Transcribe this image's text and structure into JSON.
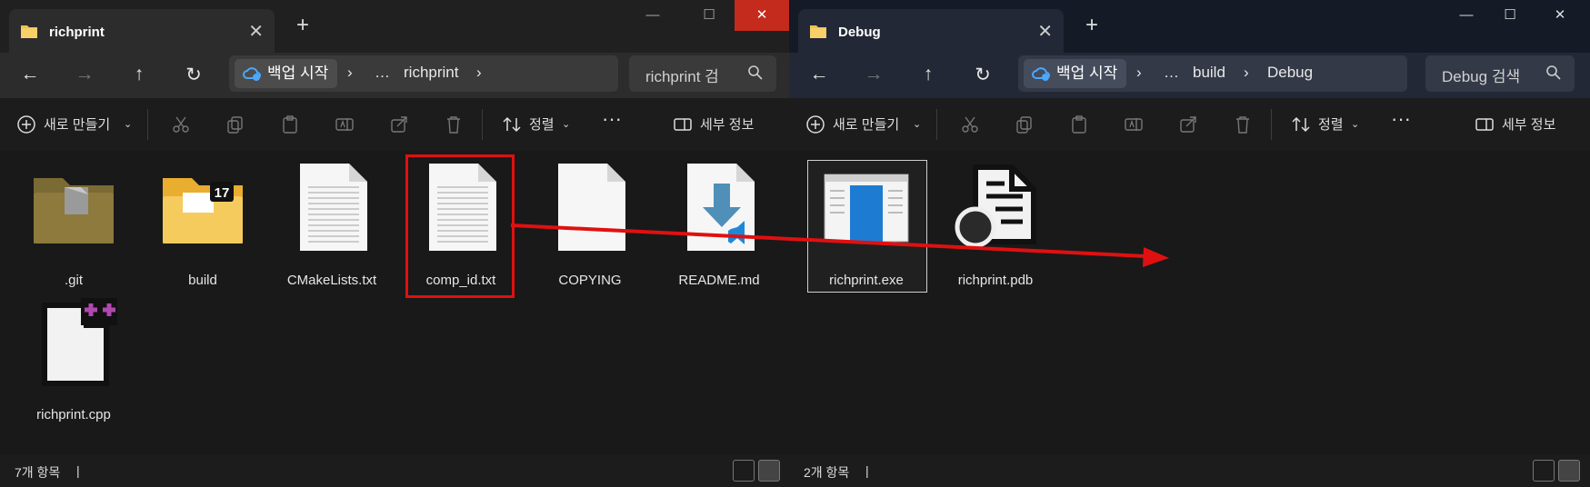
{
  "left": {
    "tab_title": "richprint",
    "address": {
      "root_label": "백업 시작",
      "crumbs": [
        "…",
        "richprint",
        "›"
      ]
    },
    "search_placeholder": "richprint 검",
    "status": "7개 항목",
    "items": [
      ".git",
      "build",
      "CMakeLists.txt",
      "comp_id.txt",
      "COPYING",
      "README.md",
      "richprint.cpp"
    ],
    "folder_badge": "17"
  },
  "right": {
    "tab_title": "Debug",
    "address": {
      "root_label": "백업 시작",
      "crumbs": [
        "…",
        "build",
        "Debug"
      ]
    },
    "search_placeholder": "Debug 검색",
    "status": "2개 항목",
    "items": [
      "richprint.exe",
      "richprint.pdb"
    ]
  },
  "toolbar": {
    "new_label": "새로 만들기",
    "sort_label": "정렬",
    "details_label": "세부 정보"
  },
  "icons": [
    "folder-icon",
    "back-icon",
    "forward-icon",
    "up-icon",
    "refresh-icon",
    "search-icon",
    "cut-icon",
    "copy-icon",
    "paste-icon",
    "rename-icon",
    "share-icon",
    "delete-icon",
    "sort-icon",
    "more-icon",
    "details-icon"
  ],
  "colors": {
    "annotation_red": "#e01010",
    "accent_blue": "#2a9df4"
  }
}
